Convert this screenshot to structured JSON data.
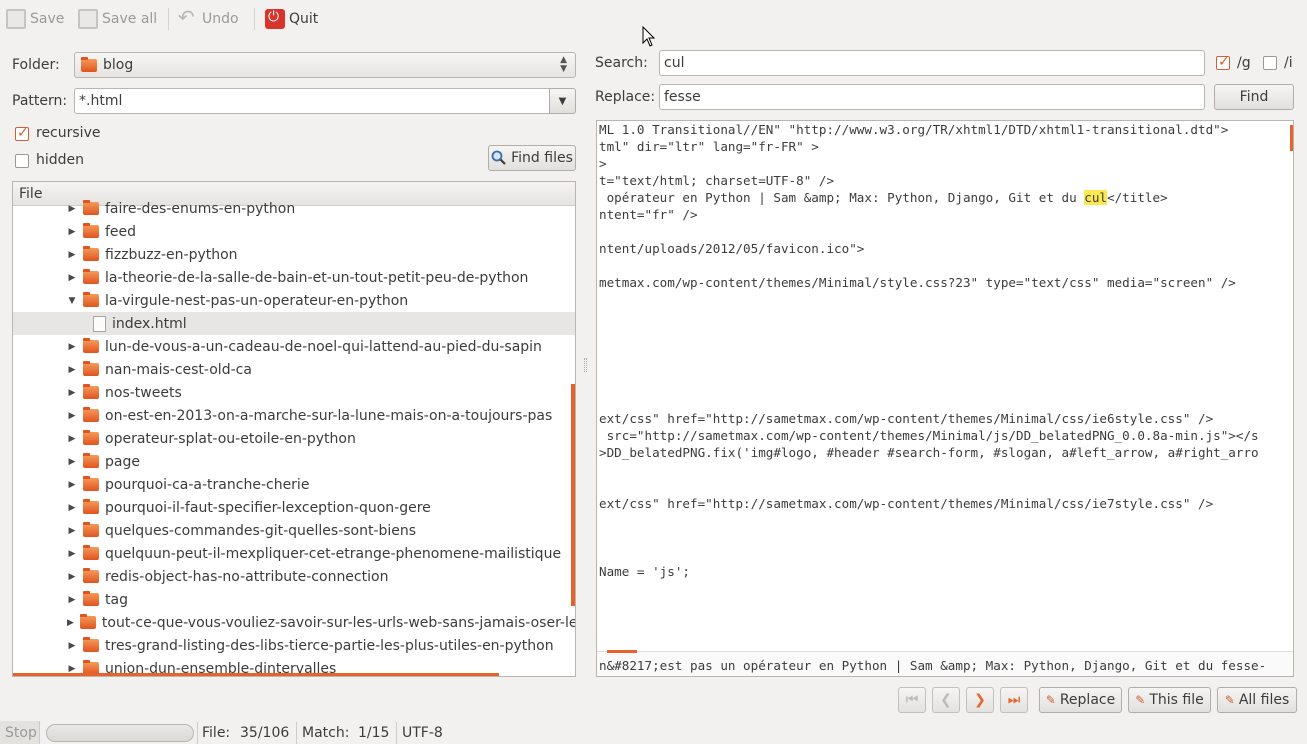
{
  "toolbar": {
    "save": "Save",
    "save_all": "Save all",
    "undo": "Undo",
    "quit": "Quit"
  },
  "left": {
    "folder_label": "Folder:",
    "folder_value": "blog",
    "pattern_label": "Pattern:",
    "pattern_value": "*.html",
    "recursive_label": "recursive",
    "recursive_checked": true,
    "hidden_label": "hidden",
    "hidden_checked": false,
    "find_files": "Find files",
    "tree_header": "File",
    "tree_items": [
      {
        "label": "faire-des-enums-en-python",
        "type": "folder",
        "expanded": false
      },
      {
        "label": "feed",
        "type": "folder",
        "expanded": false
      },
      {
        "label": "fizzbuzz-en-python",
        "type": "folder",
        "expanded": false
      },
      {
        "label": "la-theorie-de-la-salle-de-bain-et-un-tout-petit-peu-de-python",
        "type": "folder",
        "expanded": false
      },
      {
        "label": "la-virgule-nest-pas-un-operateur-en-python",
        "type": "folder",
        "expanded": true
      },
      {
        "label": "index.html",
        "type": "file",
        "selected": true
      },
      {
        "label": "lun-de-vous-a-un-cadeau-de-noel-qui-lattend-au-pied-du-sapin",
        "type": "folder",
        "expanded": false
      },
      {
        "label": "nan-mais-cest-old-ca",
        "type": "folder",
        "expanded": false
      },
      {
        "label": "nos-tweets",
        "type": "folder",
        "expanded": false
      },
      {
        "label": "on-est-en-2013-on-a-marche-sur-la-lune-mais-on-a-toujours-pas",
        "type": "folder",
        "expanded": false
      },
      {
        "label": "operateur-splat-ou-etoile-en-python",
        "type": "folder",
        "expanded": false
      },
      {
        "label": "page",
        "type": "folder",
        "expanded": false
      },
      {
        "label": "pourquoi-ca-a-tranche-cherie",
        "type": "folder",
        "expanded": false
      },
      {
        "label": "pourquoi-il-faut-specifier-lexception-quon-gere",
        "type": "folder",
        "expanded": false
      },
      {
        "label": "quelques-commandes-git-quelles-sont-biens",
        "type": "folder",
        "expanded": false
      },
      {
        "label": "quelquun-peut-il-mexpliquer-cet-etrange-phenomene-mailistique",
        "type": "folder",
        "expanded": false
      },
      {
        "label": "redis-object-has-no-attribute-connection",
        "type": "folder",
        "expanded": false
      },
      {
        "label": "tag",
        "type": "folder",
        "expanded": false
      },
      {
        "label": "tout-ce-que-vous-vouliez-savoir-sur-les-urls-web-sans-jamais-oser-le-der",
        "type": "folder",
        "expanded": false
      },
      {
        "label": "tres-grand-listing-des-libs-tierce-partie-les-plus-utiles-en-python",
        "type": "folder",
        "expanded": false
      },
      {
        "label": "union-dun-ensemble-dintervalles",
        "type": "folder",
        "expanded": false
      }
    ]
  },
  "right": {
    "search_label": "Search:",
    "search_value": "cul",
    "g_label": "/g",
    "g_checked": true,
    "i_label": "/i",
    "i_checked": false,
    "replace_label": "Replace:",
    "replace_value": "fesse",
    "find_button": "Find",
    "code_lines": [
      "ML 1.0 Transitional//EN\" \"http://www.w3.org/TR/xhtml1/DTD/xhtml1-transitional.dtd\">",
      "tml\" dir=\"ltr\" lang=\"fr-FR\" >",
      ">",
      "t=\"text/html; charset=UTF-8\" />",
      " opérateur en Python | Sam &amp; Max: Python, Django, Git et du ",
      "ntent=\"fr\" />",
      "",
      "ntent/uploads/2012/05/favicon.ico\">",
      "",
      "metmax.com/wp-content/themes/Minimal/style.css?23\" type=\"text/css\" media=\"screen\" />",
      "",
      "",
      "",
      "",
      "",
      "",
      "",
      "ext/css\" href=\"http://sametmax.com/wp-content/themes/Minimal/css/ie6style.css\" />",
      " src=\"http://sametmax.com/wp-content/themes/Minimal/js/DD_belatedPNG_0.0.8a-min.js\"></s",
      ">DD_belatedPNG.fix('img#logo, #header #search-form, #slogan, a#left_arrow, a#right_arro",
      "",
      "",
      "ext/css\" href=\"http://sametmax.com/wp-content/themes/Minimal/css/ie7style.css\" />",
      "",
      "",
      "",
      "Name = 'js';"
    ],
    "highlight_match": "cul",
    "highlight_suffix": "</title>",
    "preview_line": "n&#8217;est pas un opérateur en Python | Sam &amp; Max: Python, Django, Git et du fesse-",
    "replace_button": "Replace",
    "this_file_button": "This file",
    "all_files_button": "All files"
  },
  "status": {
    "stop": "Stop",
    "file_label": "File:",
    "file_value": "35/106",
    "match_label": "Match:",
    "match_value": "1/15",
    "encoding": "UTF-8"
  },
  "colors": {
    "accent": "#e9622b",
    "highlight": "#fce94f"
  }
}
